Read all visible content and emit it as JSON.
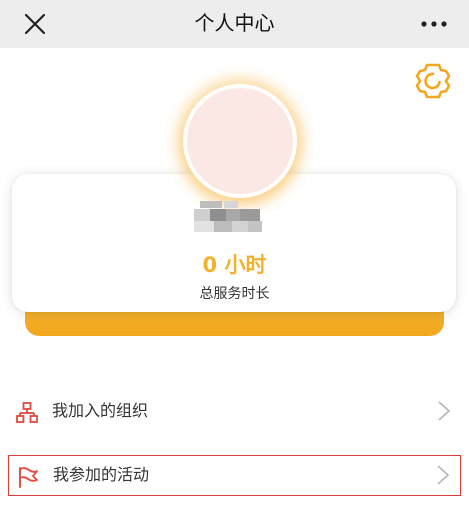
{
  "header": {
    "title": "个人中心",
    "close_icon": "close-icon",
    "more_icon": "more-icon"
  },
  "profile": {
    "settings_icon": "gear-icon",
    "avatar": "avatar",
    "username_masked": true,
    "service_hours": "0 小时",
    "service_hours_label": "总服务时长"
  },
  "menu": {
    "items": [
      {
        "label": "我加入的组织",
        "icon": "organization-icon"
      },
      {
        "label": "我参加的活动",
        "icon": "flag-icon",
        "highlighted": true
      }
    ]
  },
  "colors": {
    "accent": "#f4b12e",
    "accent_bar": "#f2a71d",
    "menu_icon": "#e04a3f",
    "highlight_border": "#e03b3b",
    "topbar": "#ededed"
  }
}
